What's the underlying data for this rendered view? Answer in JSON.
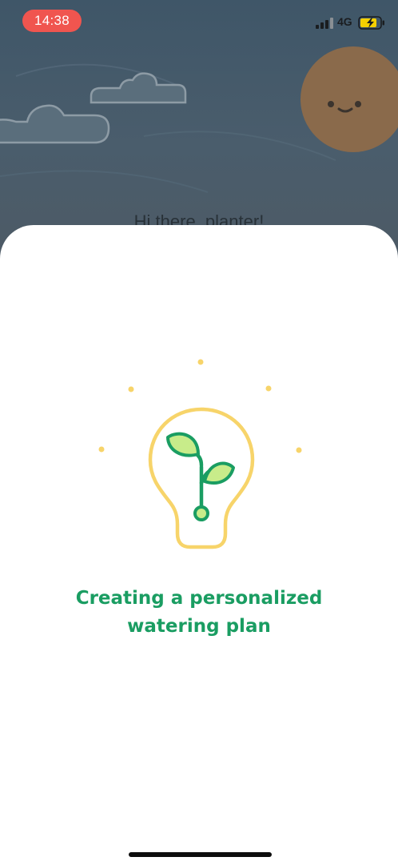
{
  "status_bar": {
    "time": "14:38",
    "network": "4G",
    "icons": [
      "signal-icon",
      "battery-charging-icon"
    ]
  },
  "background": {
    "greeting": "Hi there, planter!",
    "icons": [
      "cloud-icon",
      "cloud-icon",
      "sun-face-icon"
    ]
  },
  "loading_sheet": {
    "illustration_icon": "lightbulb-sprout-icon",
    "message_line1": "Creating a personalized",
    "message_line2": "watering plan"
  },
  "colors": {
    "accent_green": "#1a9d62",
    "leaf_light": "#c8ec8a",
    "bulb_yellow": "#f7d46a",
    "time_pill": "#f0554f"
  }
}
